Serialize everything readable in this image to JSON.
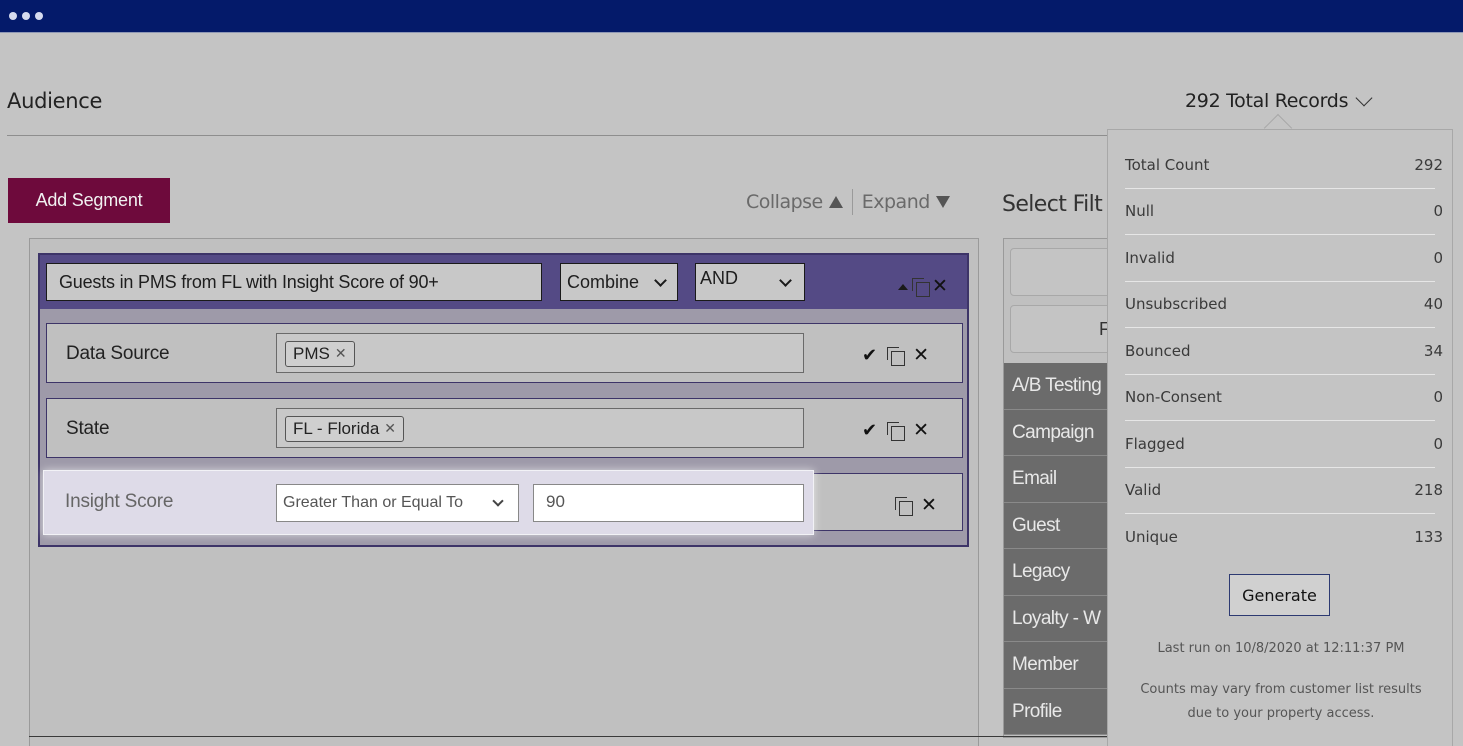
{
  "page": {
    "title": "Audience",
    "total_records_label": "292 Total Records",
    "add_segment": "Add Segment",
    "collapse": "Collapse",
    "expand": "Expand",
    "select_filter": "Select Filt"
  },
  "segment": {
    "name": "Guests in PMS from FL with Insight Score of 90+",
    "combine": "Combine",
    "operator": "AND",
    "rules": [
      {
        "label": "Data Source",
        "chip": "PMS"
      },
      {
        "label": "State",
        "chip": "FL - Florida"
      },
      {
        "label": "Insight Score",
        "comparison": "Greater Than or Equal To",
        "value": "90"
      }
    ]
  },
  "filters": {
    "button2_fragment": "F",
    "categories": [
      "A/B Testing",
      "Campaign",
      "Email",
      "Guest",
      "Legacy",
      "Loyalty - W",
      "Member",
      "Profile"
    ]
  },
  "counts": {
    "rows": [
      {
        "label": "Total Count",
        "value": "292"
      },
      {
        "label": "Null",
        "value": "0"
      },
      {
        "label": "Invalid",
        "value": "0"
      },
      {
        "label": "Unsubscribed",
        "value": "40"
      },
      {
        "label": "Bounced",
        "value": "34"
      },
      {
        "label": "Non-Consent",
        "value": "0"
      },
      {
        "label": "Flagged",
        "value": "0"
      },
      {
        "label": "Valid",
        "value": "218"
      },
      {
        "label": "Unique",
        "value": "133"
      }
    ],
    "generate": "Generate",
    "last_run": "Last run on 10/8/2020 at 12:11:37 PM",
    "disclaimer_line1": "Counts may vary from customer list results",
    "disclaimer_line2": "due to your property access."
  },
  "colors": {
    "topbar": "#041a6a",
    "add_segment": "#6e0a3c",
    "segment_header": "#544a85"
  }
}
